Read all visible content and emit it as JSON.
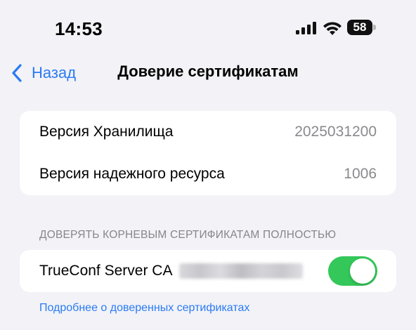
{
  "status_bar": {
    "time": "14:53",
    "battery_level": "58",
    "icons": [
      "cellular-signal-icon",
      "wifi-icon",
      "battery-icon"
    ]
  },
  "nav": {
    "back_label": "Назад",
    "title": "Доверие сертификатам"
  },
  "info": {
    "rows": [
      {
        "label": "Версия Хранилища",
        "value": "2025031200"
      },
      {
        "label": "Версия надежного ресурса",
        "value": "1006"
      }
    ]
  },
  "trust_section": {
    "header": "ДОВЕРЯТЬ КОРНЕВЫМ СЕРТИФИКАТАМ ПОЛНОСТЬЮ",
    "certificates": [
      {
        "name": "TrueConf Server CA",
        "enabled": true
      }
    ],
    "footer_link": "Подробнее о доверенных сертификатах"
  },
  "colors": {
    "accent": "#2a7bf4",
    "toggle_on": "#34c759",
    "background": "#f2f2f7",
    "secondary_text": "#8a8a8e"
  }
}
